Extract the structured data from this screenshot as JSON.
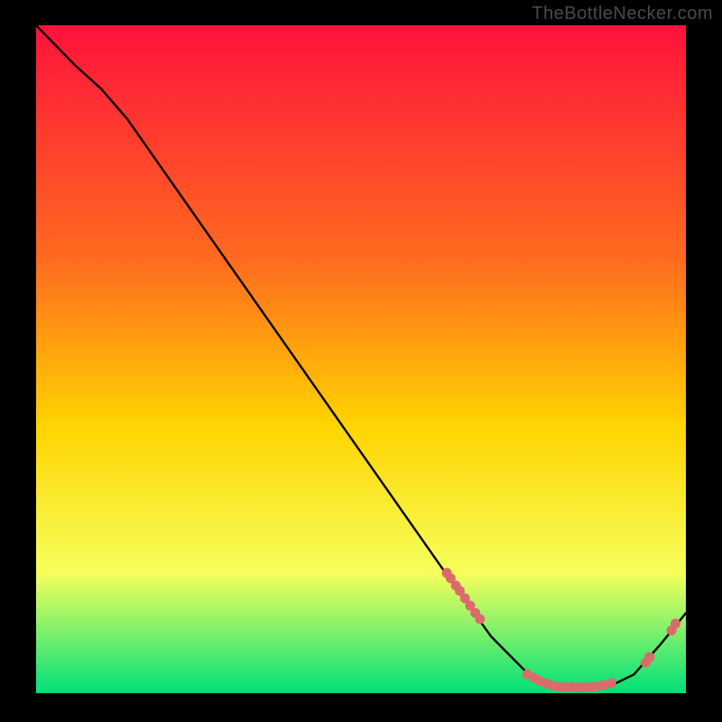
{
  "watermark": "TheBottleNecker.com",
  "colors": {
    "bg": "#000000",
    "gradient_top": "#ff123c",
    "gradient_mid_upper_y": "#ff6a1f",
    "gradient_mid_y": "#ffd400",
    "gradient_low_y": "#f6ff5c",
    "gradient_bottom": "#00e07a",
    "curve": "#000000",
    "marker_fill": "#db6b6b",
    "marker_stroke": "#c94f4f"
  },
  "chart_data": {
    "type": "line",
    "title": "",
    "xlabel": "",
    "ylabel": "",
    "xlim": [
      0,
      100
    ],
    "ylim": [
      0,
      100
    ],
    "grid": false,
    "legend": false,
    "curve_xy": [
      [
        0,
        100
      ],
      [
        6,
        94
      ],
      [
        10,
        90.5
      ],
      [
        14,
        86
      ],
      [
        63,
        18
      ],
      [
        70,
        8.5
      ],
      [
        76,
        2.6
      ],
      [
        80,
        0.9
      ],
      [
        88,
        0.9
      ],
      [
        92,
        2.8
      ],
      [
        96,
        7.2
      ],
      [
        100,
        12
      ]
    ],
    "marker_clusters": [
      {
        "name": "left-cluster",
        "points": [
          [
            63.2,
            18.0
          ],
          [
            63.8,
            17.2
          ],
          [
            64.6,
            16.1
          ],
          [
            65.2,
            15.3
          ],
          [
            66.0,
            14.2
          ],
          [
            66.8,
            13.1
          ],
          [
            67.6,
            12.0
          ],
          [
            68.3,
            11.1
          ]
        ]
      },
      {
        "name": "bottom-plateau",
        "points": [
          [
            75.6,
            2.8
          ],
          [
            76.6,
            2.3
          ],
          [
            77.6,
            1.8
          ],
          [
            78.6,
            1.4
          ],
          [
            79.6,
            1.1
          ],
          [
            80.5,
            0.95
          ],
          [
            81.5,
            0.9
          ],
          [
            82.5,
            0.9
          ],
          [
            83.5,
            0.9
          ],
          [
            84.5,
            0.9
          ],
          [
            85.5,
            0.95
          ],
          [
            86.5,
            1.05
          ],
          [
            87.5,
            1.25
          ],
          [
            88.5,
            1.5
          ]
        ]
      },
      {
        "name": "right-rise",
        "points": [
          [
            93.8,
            4.6
          ],
          [
            94.4,
            5.4
          ],
          [
            97.8,
            9.4
          ],
          [
            98.4,
            10.4
          ]
        ]
      }
    ]
  }
}
